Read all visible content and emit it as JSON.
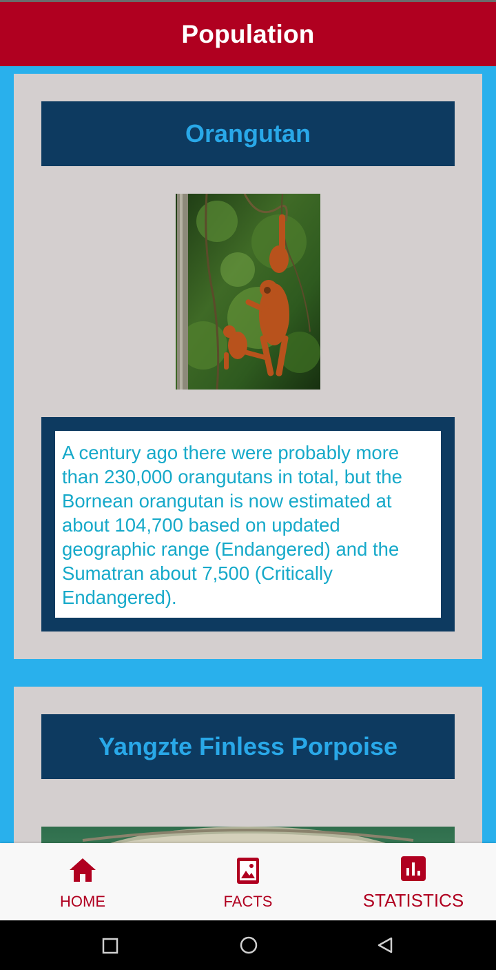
{
  "app_bar": {
    "title": "Population"
  },
  "cards": [
    {
      "title": "Orangutan",
      "image_alt": "orangutan-photo",
      "description": "A century ago there were probably more than 230,000 orangutans in total, but the Bornean orangutan is now estimated at about 104,700 based on updated geographic range (Endangered) and the Sumatran about 7,500 (Critically Endangered)."
    },
    {
      "title": "Yangzte Finless Porpoise",
      "image_alt": "porpoise-photo"
    }
  ],
  "bottom_nav": {
    "items": [
      {
        "label": "HOME",
        "icon": "home-icon"
      },
      {
        "label": "FACTS",
        "icon": "photo-icon"
      },
      {
        "label": "STATISTICS",
        "icon": "bar-chart-icon"
      }
    ]
  },
  "system_nav": {
    "buttons": [
      "recents-button",
      "home-button",
      "back-button"
    ]
  },
  "colors": {
    "app_bar": "#b00020",
    "background": "#29b0ec",
    "card": "#d4cfcf",
    "title_box": "#0d3a60",
    "title_text": "#29a8e8",
    "description_text": "#16a9c9",
    "nav_accent": "#b00020"
  }
}
